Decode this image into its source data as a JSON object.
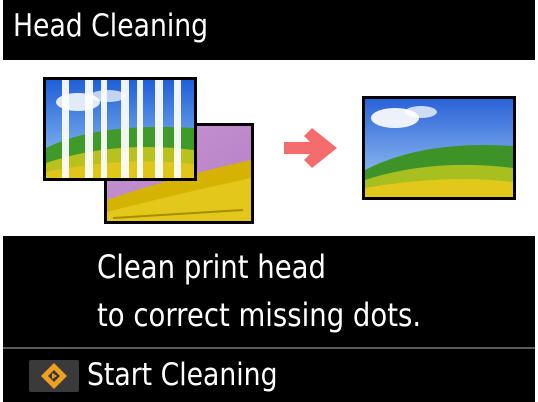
{
  "header": {
    "title": "Head Cleaning"
  },
  "illustration": {
    "before_icon": "banded-print-photo-icon",
    "arrow_icon": "right-arrow-icon",
    "after_icon": "clean-print-photo-icon",
    "arrow_color": "#f46c6c"
  },
  "description": {
    "line1": "Clean print head",
    "line2": "to correct missing dots."
  },
  "footer": {
    "start_icon": "start-diamond-icon",
    "start_label": "Start Cleaning",
    "start_icon_color": "#f0a020"
  }
}
